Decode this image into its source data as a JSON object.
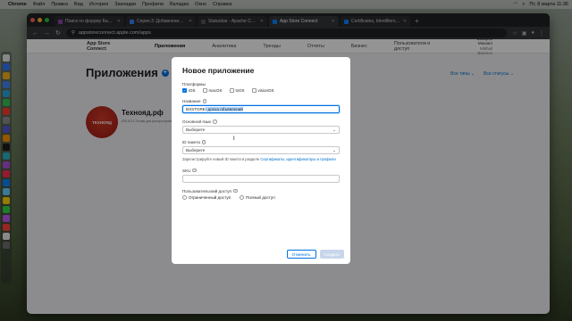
{
  "menubar": {
    "app": "Chrome",
    "items": [
      "Файл",
      "Правка",
      "Вид",
      "История",
      "Закладки",
      "Профили",
      "Вкладка",
      "Окно",
      "Справка"
    ],
    "clock": "Пт, 8 марта 11:36"
  },
  "tabs": [
    {
      "title": "Поиск по форуму Базалог…",
      "color": "#8e44ad"
    },
    {
      "title": "Серия 3: Добавление прило…",
      "color": "#3b82f6"
    },
    {
      "title": "Statuobar - Apache Cordova",
      "color": "#555555"
    },
    {
      "title": "App Store Connect",
      "color": "#0a84ff",
      "active": true
    },
    {
      "title": "Certificates, Identifiers & Pro…",
      "color": "#0a84ff"
    }
  ],
  "address": {
    "url": "appstoreconnect.apple.com/apps"
  },
  "asc": {
    "logo": "App Store Connect",
    "nav": [
      "Приложения",
      "Аналитика",
      "Тренды",
      "Отчеты",
      "Бизнес",
      "Пользователи и доступ"
    ],
    "user_name": "Базаров Михаил",
    "user_sub": "Mikhail Bazarov"
  },
  "page": {
    "title": "Приложения",
    "filter_types": "Все типы ⌄",
    "filter_status": "Все статусы ⌄",
    "app_name": "Технояд.рф",
    "app_icon_text": "ТЕХНОЯД",
    "app_meta": "iOS 8.0.1 Готово для распространения"
  },
  "modal": {
    "title": "Новое приложение",
    "platforms_label": "Платформы",
    "platforms": [
      {
        "label": "iOS",
        "checked": true
      },
      {
        "label": "macOS",
        "checked": false
      },
      {
        "label": "tvOS",
        "checked": false
      },
      {
        "label": "visionOS",
        "checked": false
      }
    ],
    "name_label": "Название",
    "name_value_prefix": "BXSTORE",
    "name_value_selected": " - доска объявлений",
    "language_label": "Основной язык",
    "language_value": "Выберите",
    "bundle_label": "ID пакета",
    "bundle_value": "Выберите",
    "bundle_hint": "Зарегистрируйте новый ID пакета в разделе",
    "bundle_hint_link": "Сертификаты, идентификаторы и профили",
    "sku_label": "SKU",
    "access_label": "Пользовательский доступ",
    "access_options": [
      "Ограниченный доступ",
      "Полный доступ"
    ],
    "cancel": "Отменить",
    "create": "Создать"
  },
  "colors": {
    "accent": "#0071e3"
  }
}
